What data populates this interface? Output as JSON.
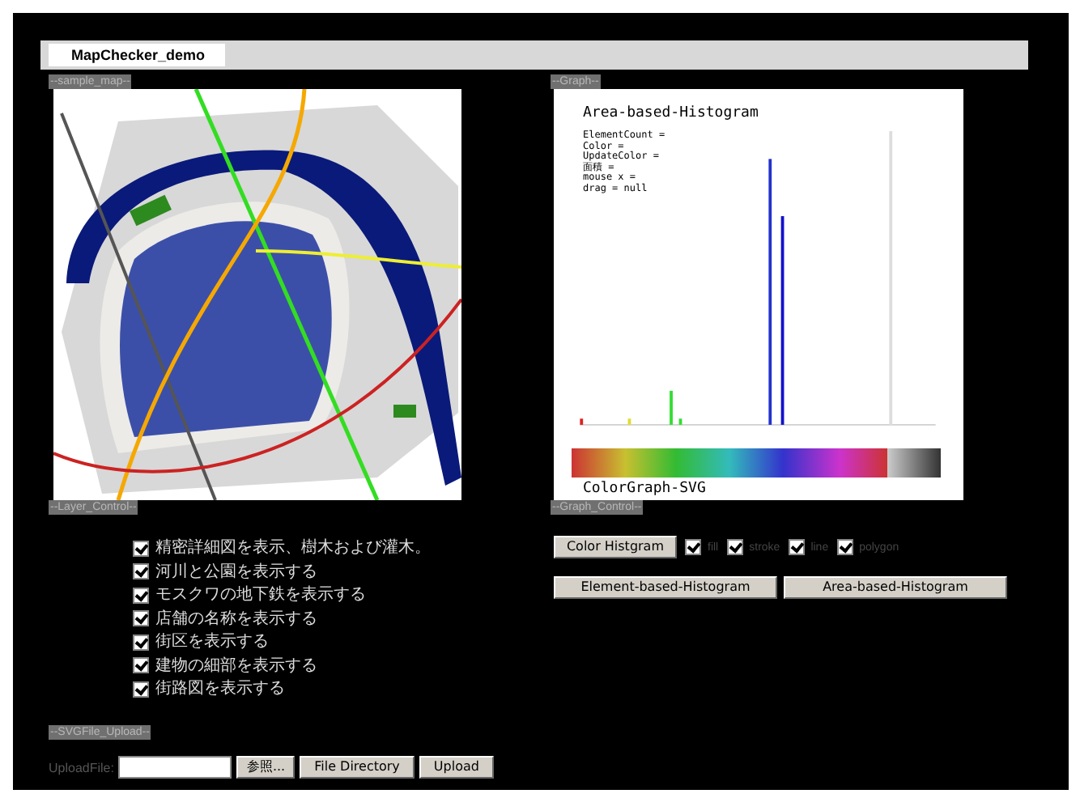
{
  "title_tab": "MapChecker_demo",
  "map_panel": {
    "label": "--sample_map--",
    "kind": "picture"
  },
  "graph_panel": {
    "label": "--Graph--",
    "title": "Area-based-Histogram",
    "info_lines": [
      "ElementCount =",
      "Color =",
      "UpdateColor =",
      "面積 =",
      "mouse x =",
      "drag = null"
    ],
    "footer": "ColorGraph-SVG"
  },
  "layer_control": {
    "label": "--Layer_Control--",
    "layers": [
      {
        "label": "精密詳細図を表示、樹木および灌木。",
        "checked": true
      },
      {
        "label": "河川と公園を表示する",
        "checked": true
      },
      {
        "label": "モスクワの地下鉄を表示する",
        "checked": true
      },
      {
        "label": "店舗の名称を表示する",
        "checked": true
      },
      {
        "label": "街区を表示する",
        "checked": true
      },
      {
        "label": "建物の細部を表示する",
        "checked": true
      },
      {
        "label": "街路図を表示する",
        "checked": true
      }
    ]
  },
  "graph_control": {
    "label": "--Graph_Control--",
    "color_button": "Color Histgram",
    "filters": [
      {
        "label": "fill",
        "checked": true
      },
      {
        "label": "stroke",
        "checked": true
      },
      {
        "label": "line",
        "checked": true
      },
      {
        "label": "polygon",
        "checked": true
      }
    ],
    "histogram_buttons": [
      "Element-based-Histogram",
      "Area-based-Histogram"
    ]
  },
  "upload": {
    "label": "--SVGFile_Upload--",
    "field_label": "UploadFile:",
    "browse_button": "参照...",
    "buttons": [
      "File Directory",
      "Upload"
    ]
  }
}
